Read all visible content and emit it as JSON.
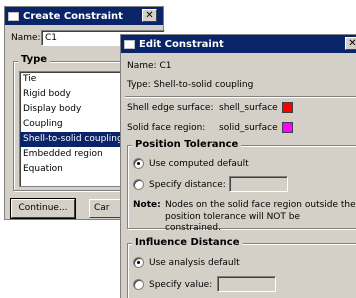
{
  "create_constraint": {
    "title": "Create Constraint",
    "name_label": "Name:",
    "name_value": "C1",
    "type_group_title": "Type",
    "type_items": [
      "Tie",
      "Rigid body",
      "Display body",
      "Coupling",
      "Shell-to-solid coupling",
      "Embedded region",
      "Equation"
    ],
    "selected_index": 4,
    "continue_label": "Continue...",
    "cancel_label": "Car"
  },
  "edit_constraint": {
    "title": "Edit Constraint",
    "name_line": "Name:  C1",
    "type_line": "Type:   Shell-to-solid coupling",
    "shell_edge_label": "Shell edge surface:",
    "shell_edge_value": "shell_surface",
    "shell_edge_color": "#ff0000",
    "solid_face_label": "Solid face region:",
    "solid_face_value": "solid_surface",
    "solid_face_color": "#ff00ff",
    "position_tolerance": {
      "title": "Position Tolerance",
      "option1": "Use computed default",
      "option2": "Specify distance:",
      "selected": "option1",
      "note_label": "Note:",
      "note_line1": "Nodes on the solid face region outside the",
      "note_line2": "position tolerance will NOT be constrained."
    },
    "influence_distance": {
      "title": "Influence Distance",
      "option1": "Use analysis default",
      "option2": "Specify value:",
      "selected": "option1"
    }
  }
}
